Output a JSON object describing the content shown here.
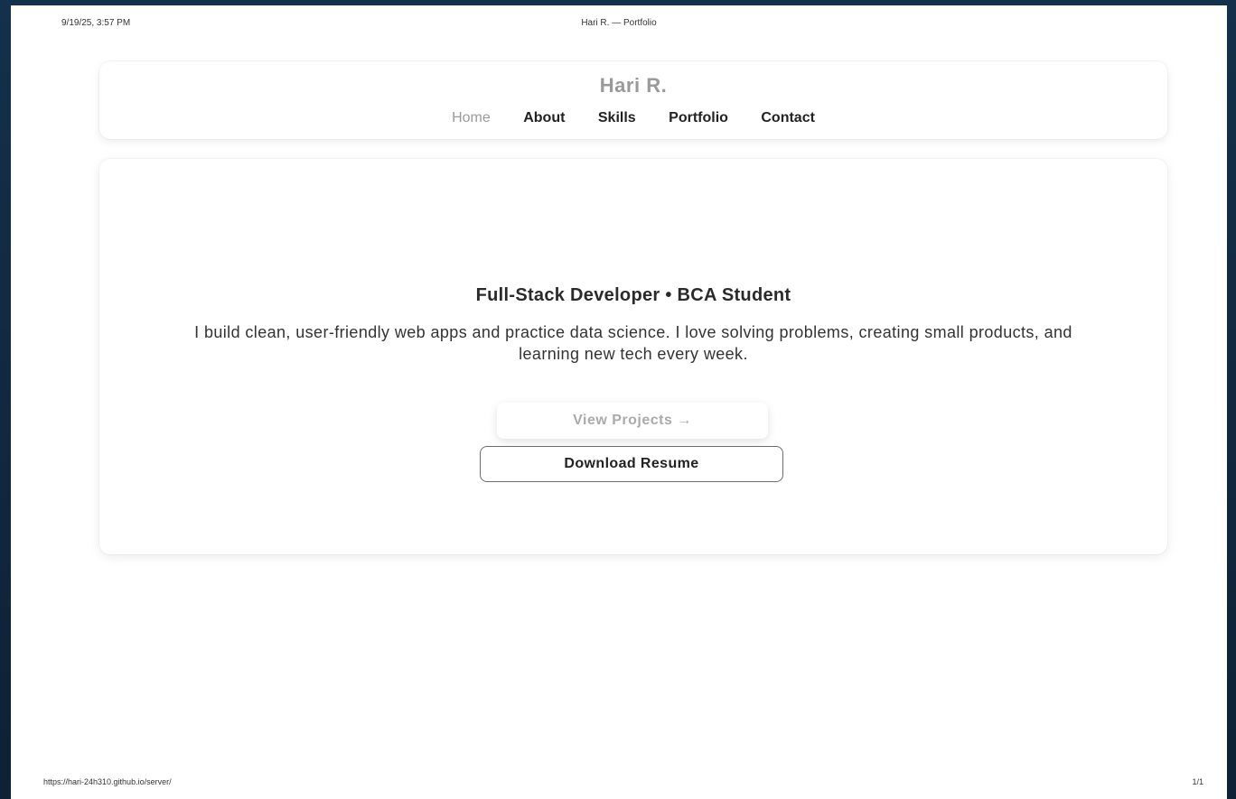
{
  "print": {
    "date": "9/19/25, 3:57 PM",
    "title": "Hari R. — Portfolio",
    "url": "https://hari-24h310.github.io/server/",
    "page": "1/1"
  },
  "brand": "Hari R.",
  "nav": {
    "items": [
      {
        "label": "Home",
        "active": true
      },
      {
        "label": "About",
        "active": false
      },
      {
        "label": "Skills",
        "active": false
      },
      {
        "label": "Portfolio",
        "active": false
      },
      {
        "label": "Contact",
        "active": false
      }
    ]
  },
  "hero": {
    "title": "Full-Stack Developer • BCA Student",
    "description": "I build clean, user-friendly web apps and practice data science. I love solving problems, creating small products, and learning new tech every week.",
    "primary_button": "View Projects →",
    "secondary_button": "Download Resume"
  },
  "colors": {
    "background": "#0f2236",
    "card": "#ffffff",
    "muted": "#9a9a9a",
    "text": "#222222"
  }
}
